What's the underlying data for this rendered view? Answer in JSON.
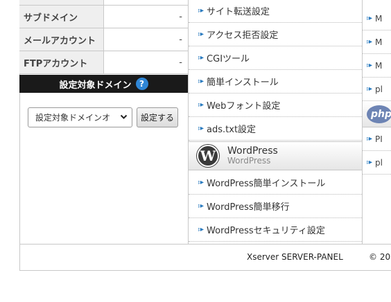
{
  "stats": [
    {
      "label": "",
      "value": ""
    },
    {
      "label": "サブドメイン",
      "value": "-"
    },
    {
      "label": "メールアカウント",
      "value": "-"
    },
    {
      "label": "FTPアカウント",
      "value": "-"
    }
  ],
  "domain_panel": {
    "title": "設定対象ドメイン",
    "help": "?",
    "select_value": "設定対象ドメインオ",
    "button_label": "設定する"
  },
  "menu": {
    "items": [
      "サイト転送設定",
      "アクセス拒否設定",
      "CGIツール",
      "簡単インストール",
      "Webフォント設定",
      "ads.txt設定"
    ],
    "wordpress": {
      "title": "WordPress",
      "subtitle": "WordPress",
      "items": [
        "WordPress簡単インストール",
        "WordPress簡単移行",
        "WordPressセキュリティ設定"
      ]
    }
  },
  "right_menu": {
    "items_top": [
      "M",
      "M",
      "M",
      "pl"
    ],
    "php_logo": "php",
    "items_bottom": [
      "PI",
      "pl"
    ]
  },
  "footer": {
    "brand": "Xserver SERVER-PANEL",
    "copyright": "© 20"
  }
}
